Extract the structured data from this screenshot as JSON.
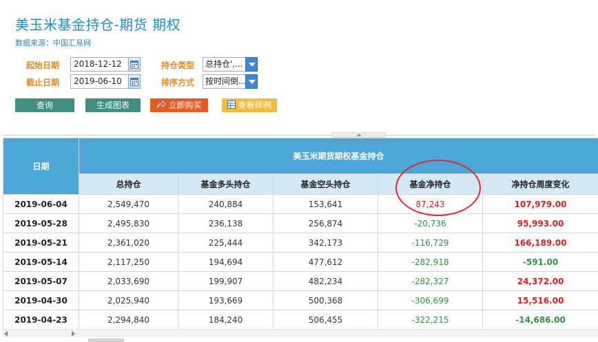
{
  "header": {
    "title": "美玉米基金持仓-期货 期权",
    "source": "数据来源：中国汇易网"
  },
  "filters": {
    "start_label": "起始日期",
    "start_value": "2018-12-12",
    "end_label": "截止日期",
    "end_value": "2019-06-10",
    "type_label": "持仓类型",
    "type_value": "总持仓',...",
    "sort_label": "排序方式",
    "sort_value": "按时间倒..."
  },
  "buttons": {
    "query": "查询",
    "chart": "生成图表",
    "buy": "立即购买",
    "sample": "查看样例"
  },
  "table": {
    "date_header": "日期",
    "group_header": "美玉米期货期权基金持仓",
    "columns": [
      "总持仓",
      "基金多头持仓",
      "基金空头持仓",
      "基金净持仓",
      "净持仓周度变化"
    ],
    "rows": [
      {
        "date": "2019-06-04",
        "total": "2,549,470",
        "long": "240,884",
        "short": "153,641",
        "net": "87,243",
        "change": "107,979.00"
      },
      {
        "date": "2019-05-28",
        "total": "2,495,830",
        "long": "236,138",
        "short": "256,874",
        "net": "-20,736",
        "change": "95,993.00"
      },
      {
        "date": "2019-05-21",
        "total": "2,361,020",
        "long": "225,444",
        "short": "342,173",
        "net": "-116,729",
        "change": "166,189.00"
      },
      {
        "date": "2019-05-14",
        "total": "2,117,250",
        "long": "194,694",
        "short": "477,612",
        "net": "-282,918",
        "change": "-591.00"
      },
      {
        "date": "2019-05-07",
        "total": "2,033,690",
        "long": "199,907",
        "short": "482,234",
        "net": "-282,327",
        "change": "24,372.00"
      },
      {
        "date": "2019-04-30",
        "total": "2,025,940",
        "long": "193,669",
        "short": "500,368",
        "net": "-306,699",
        "change": "15,516.00"
      },
      {
        "date": "2019-04-23",
        "total": "2,294,840",
        "long": "184,240",
        "short": "506,455",
        "net": "-322,215",
        "change": "-14,686.00"
      }
    ]
  },
  "colors": {
    "header_bg": "#4aa7d8",
    "subheader_bg": "#d3e9f6",
    "negative": "#2f8f3f",
    "positive": "#e21c1c",
    "highlight_circle": "#e0282e"
  }
}
